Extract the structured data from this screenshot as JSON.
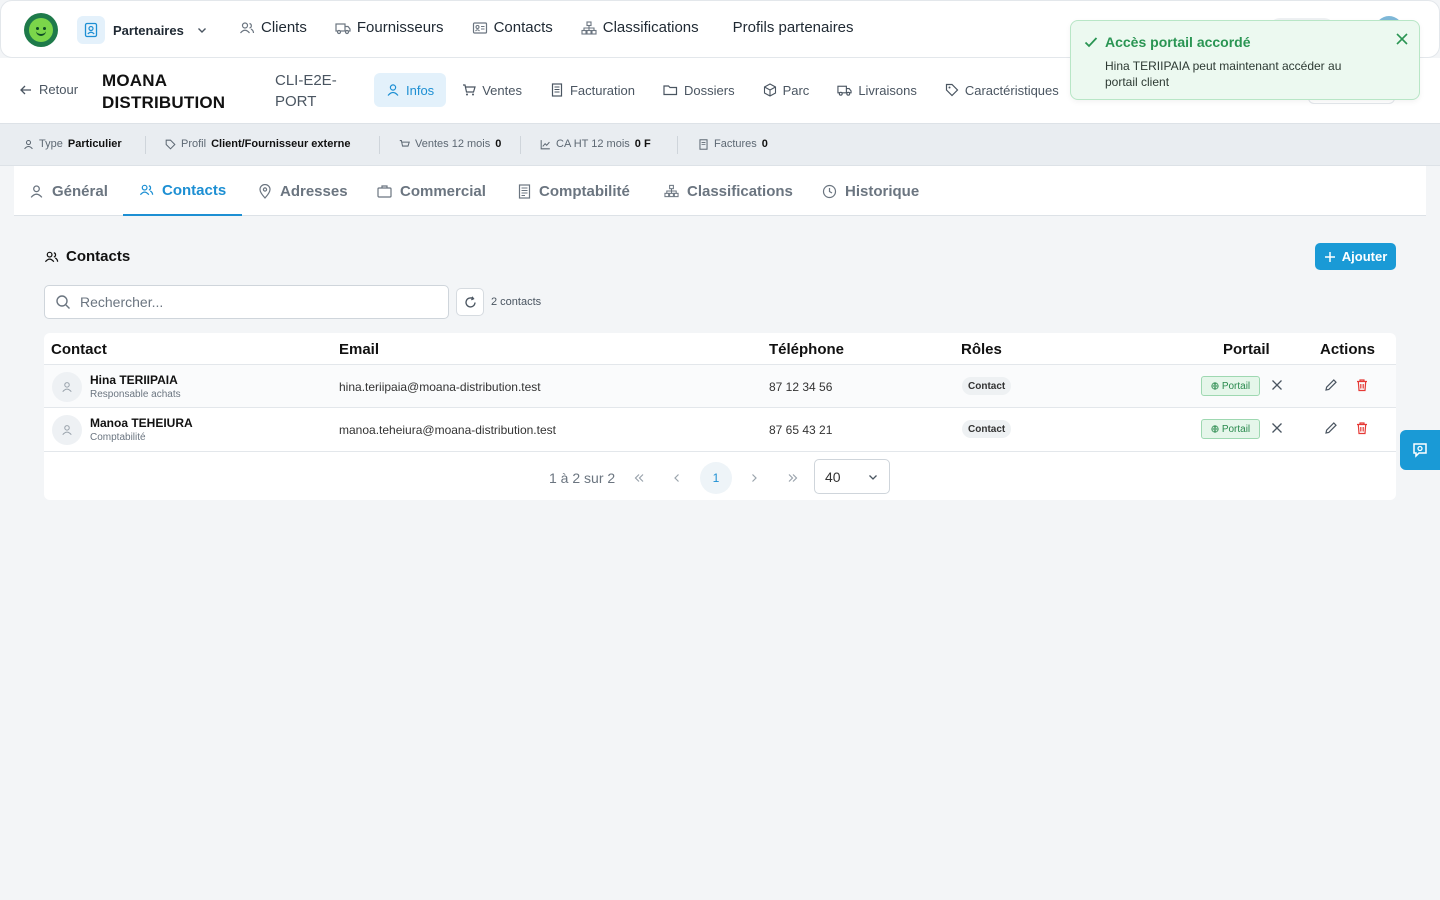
{
  "topnav": {
    "module": "Partenaires",
    "items": [
      {
        "label": "Clients",
        "icon": "users-icon"
      },
      {
        "label": "Fournisseurs",
        "icon": "truck-icon"
      },
      {
        "label": "Contacts",
        "icon": "contact-card-icon"
      },
      {
        "label": "Classifications",
        "icon": "hierarchy-icon"
      },
      {
        "label": "Profils partenaires",
        "icon": ""
      }
    ]
  },
  "record": {
    "back_label": "Retour",
    "name": "MOANA DISTRIBUTION",
    "code": "CLI-E2E-PORT",
    "tabs": [
      {
        "label": "Infos",
        "icon": "user-icon",
        "active": true
      },
      {
        "label": "Ventes",
        "icon": "cart-icon"
      },
      {
        "label": "Facturation",
        "icon": "invoice-icon"
      },
      {
        "label": "Dossiers",
        "icon": "folder-icon"
      },
      {
        "label": "Parc",
        "icon": "box-icon"
      },
      {
        "label": "Livraisons",
        "icon": "truck-icon"
      },
      {
        "label": "Caractéristiques",
        "icon": "tag-icon"
      }
    ]
  },
  "info_strip": {
    "type_label": "Type",
    "type_value": "Particulier",
    "profil_label": "Profil",
    "profil_value": "Client/Fournisseur externe",
    "ventes_label": "Ventes 12 mois",
    "ventes_value": "0",
    "ca_label": "CA HT 12 mois",
    "ca_value": "0 F",
    "factures_label": "Factures",
    "factures_value": "0"
  },
  "subtabs": [
    {
      "label": "Général",
      "icon": "user-icon"
    },
    {
      "label": "Contacts",
      "icon": "users-icon",
      "active": true
    },
    {
      "label": "Adresses",
      "icon": "map-pin-icon"
    },
    {
      "label": "Commercial",
      "icon": "briefcase-icon"
    },
    {
      "label": "Comptabilité",
      "icon": "ledger-icon"
    },
    {
      "label": "Classifications",
      "icon": "hierarchy-icon"
    },
    {
      "label": "Historique",
      "icon": "clock-icon"
    }
  ],
  "contacts": {
    "title": "Contacts",
    "add_label": "Ajouter",
    "search_placeholder": "Rechercher...",
    "count_label": "2 contacts",
    "columns": [
      "Contact",
      "Email",
      "Téléphone",
      "Rôles",
      "Portail",
      "Actions"
    ],
    "rows": [
      {
        "name": "Hina TERIIPAIA",
        "role": "Responsable achats",
        "email": "hina.teriipaia@moana-distribution.test",
        "phone": "87 12 34 56",
        "badge": "Contact",
        "portal": "Portail"
      },
      {
        "name": "Manoa TEHEIURA",
        "role": "Comptabilité",
        "email": "manoa.teheiura@moana-distribution.test",
        "phone": "87 65 43 21",
        "badge": "Contact",
        "portal": "Portail"
      }
    ],
    "pager": {
      "range_label": "1 à 2 sur 2",
      "current_page": "1",
      "per_page": "40"
    }
  },
  "toast": {
    "title": "Accès portail accordé",
    "message": "Hina TERIIPAIA peut maintenant accéder au portail client"
  },
  "colors": {
    "accent": "#1a9ad6",
    "success": "#2a9553",
    "danger": "#e53935"
  }
}
